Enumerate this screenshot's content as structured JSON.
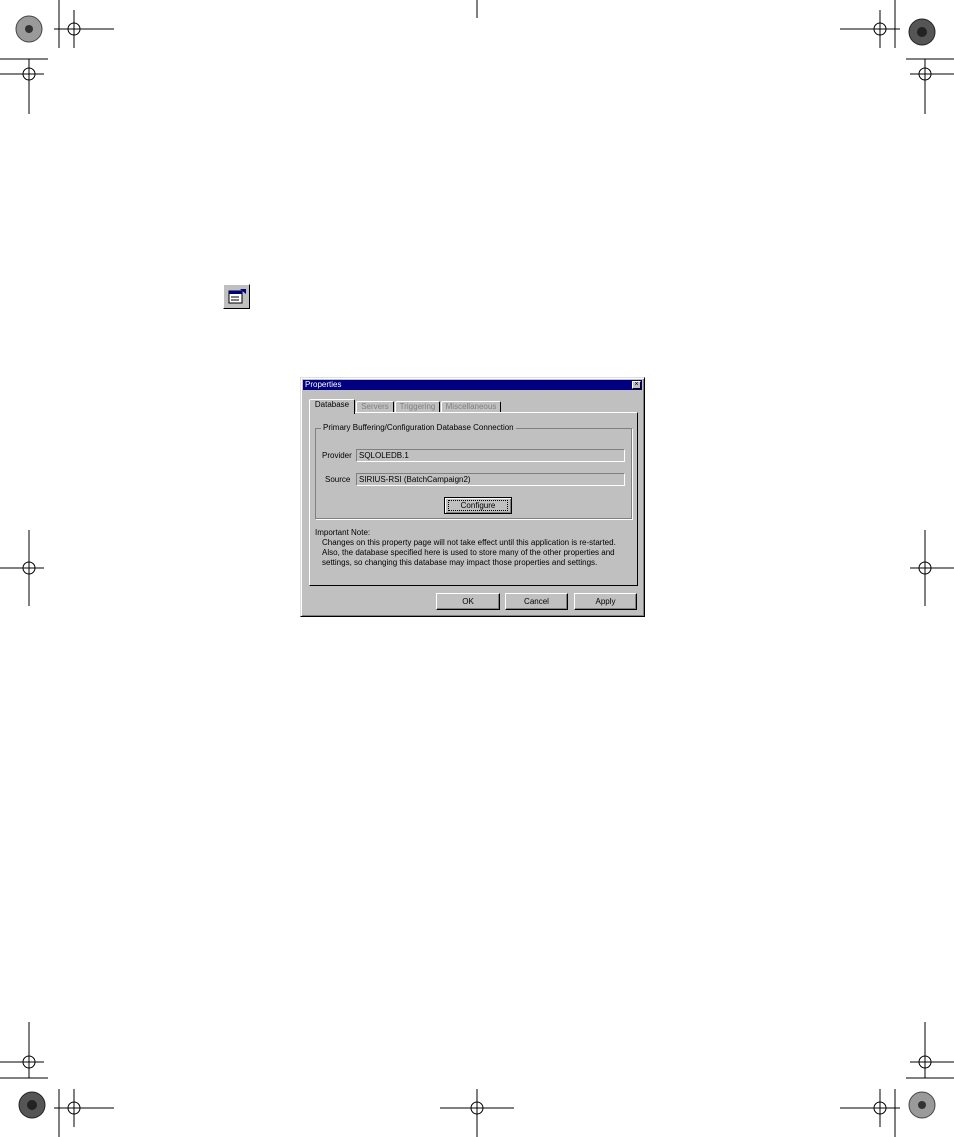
{
  "toolbar_icon": {
    "name": "properties-icon"
  },
  "dialog": {
    "title": "Properties",
    "tabs": [
      {
        "label": "Database",
        "active": true
      },
      {
        "label": "Servers",
        "active": false
      },
      {
        "label": "Triggering",
        "active": false
      },
      {
        "label": "Miscellaneous",
        "active": false
      }
    ],
    "group_title": "Primary Buffering/Configuration Database Connection",
    "provider_label": "Provider",
    "provider_value": "SQLOLEDB.1",
    "source_label": "Source",
    "source_value": "SIRIUS-RSI (BatchCampaign2)",
    "configure_button": "Configure",
    "note_heading": "Important Note:",
    "note_lines": [
      "Changes on this property page will not take effect until this application is re-started.",
      "Also, the database specified here is used to store many of the other properties and",
      "settings, so changing this database may impact those properties and settings."
    ],
    "ok_button": "OK",
    "cancel_button": "Cancel",
    "apply_button": "Apply"
  },
  "colors": {
    "titlebar": "#000080",
    "face": "#c0c0c0"
  }
}
